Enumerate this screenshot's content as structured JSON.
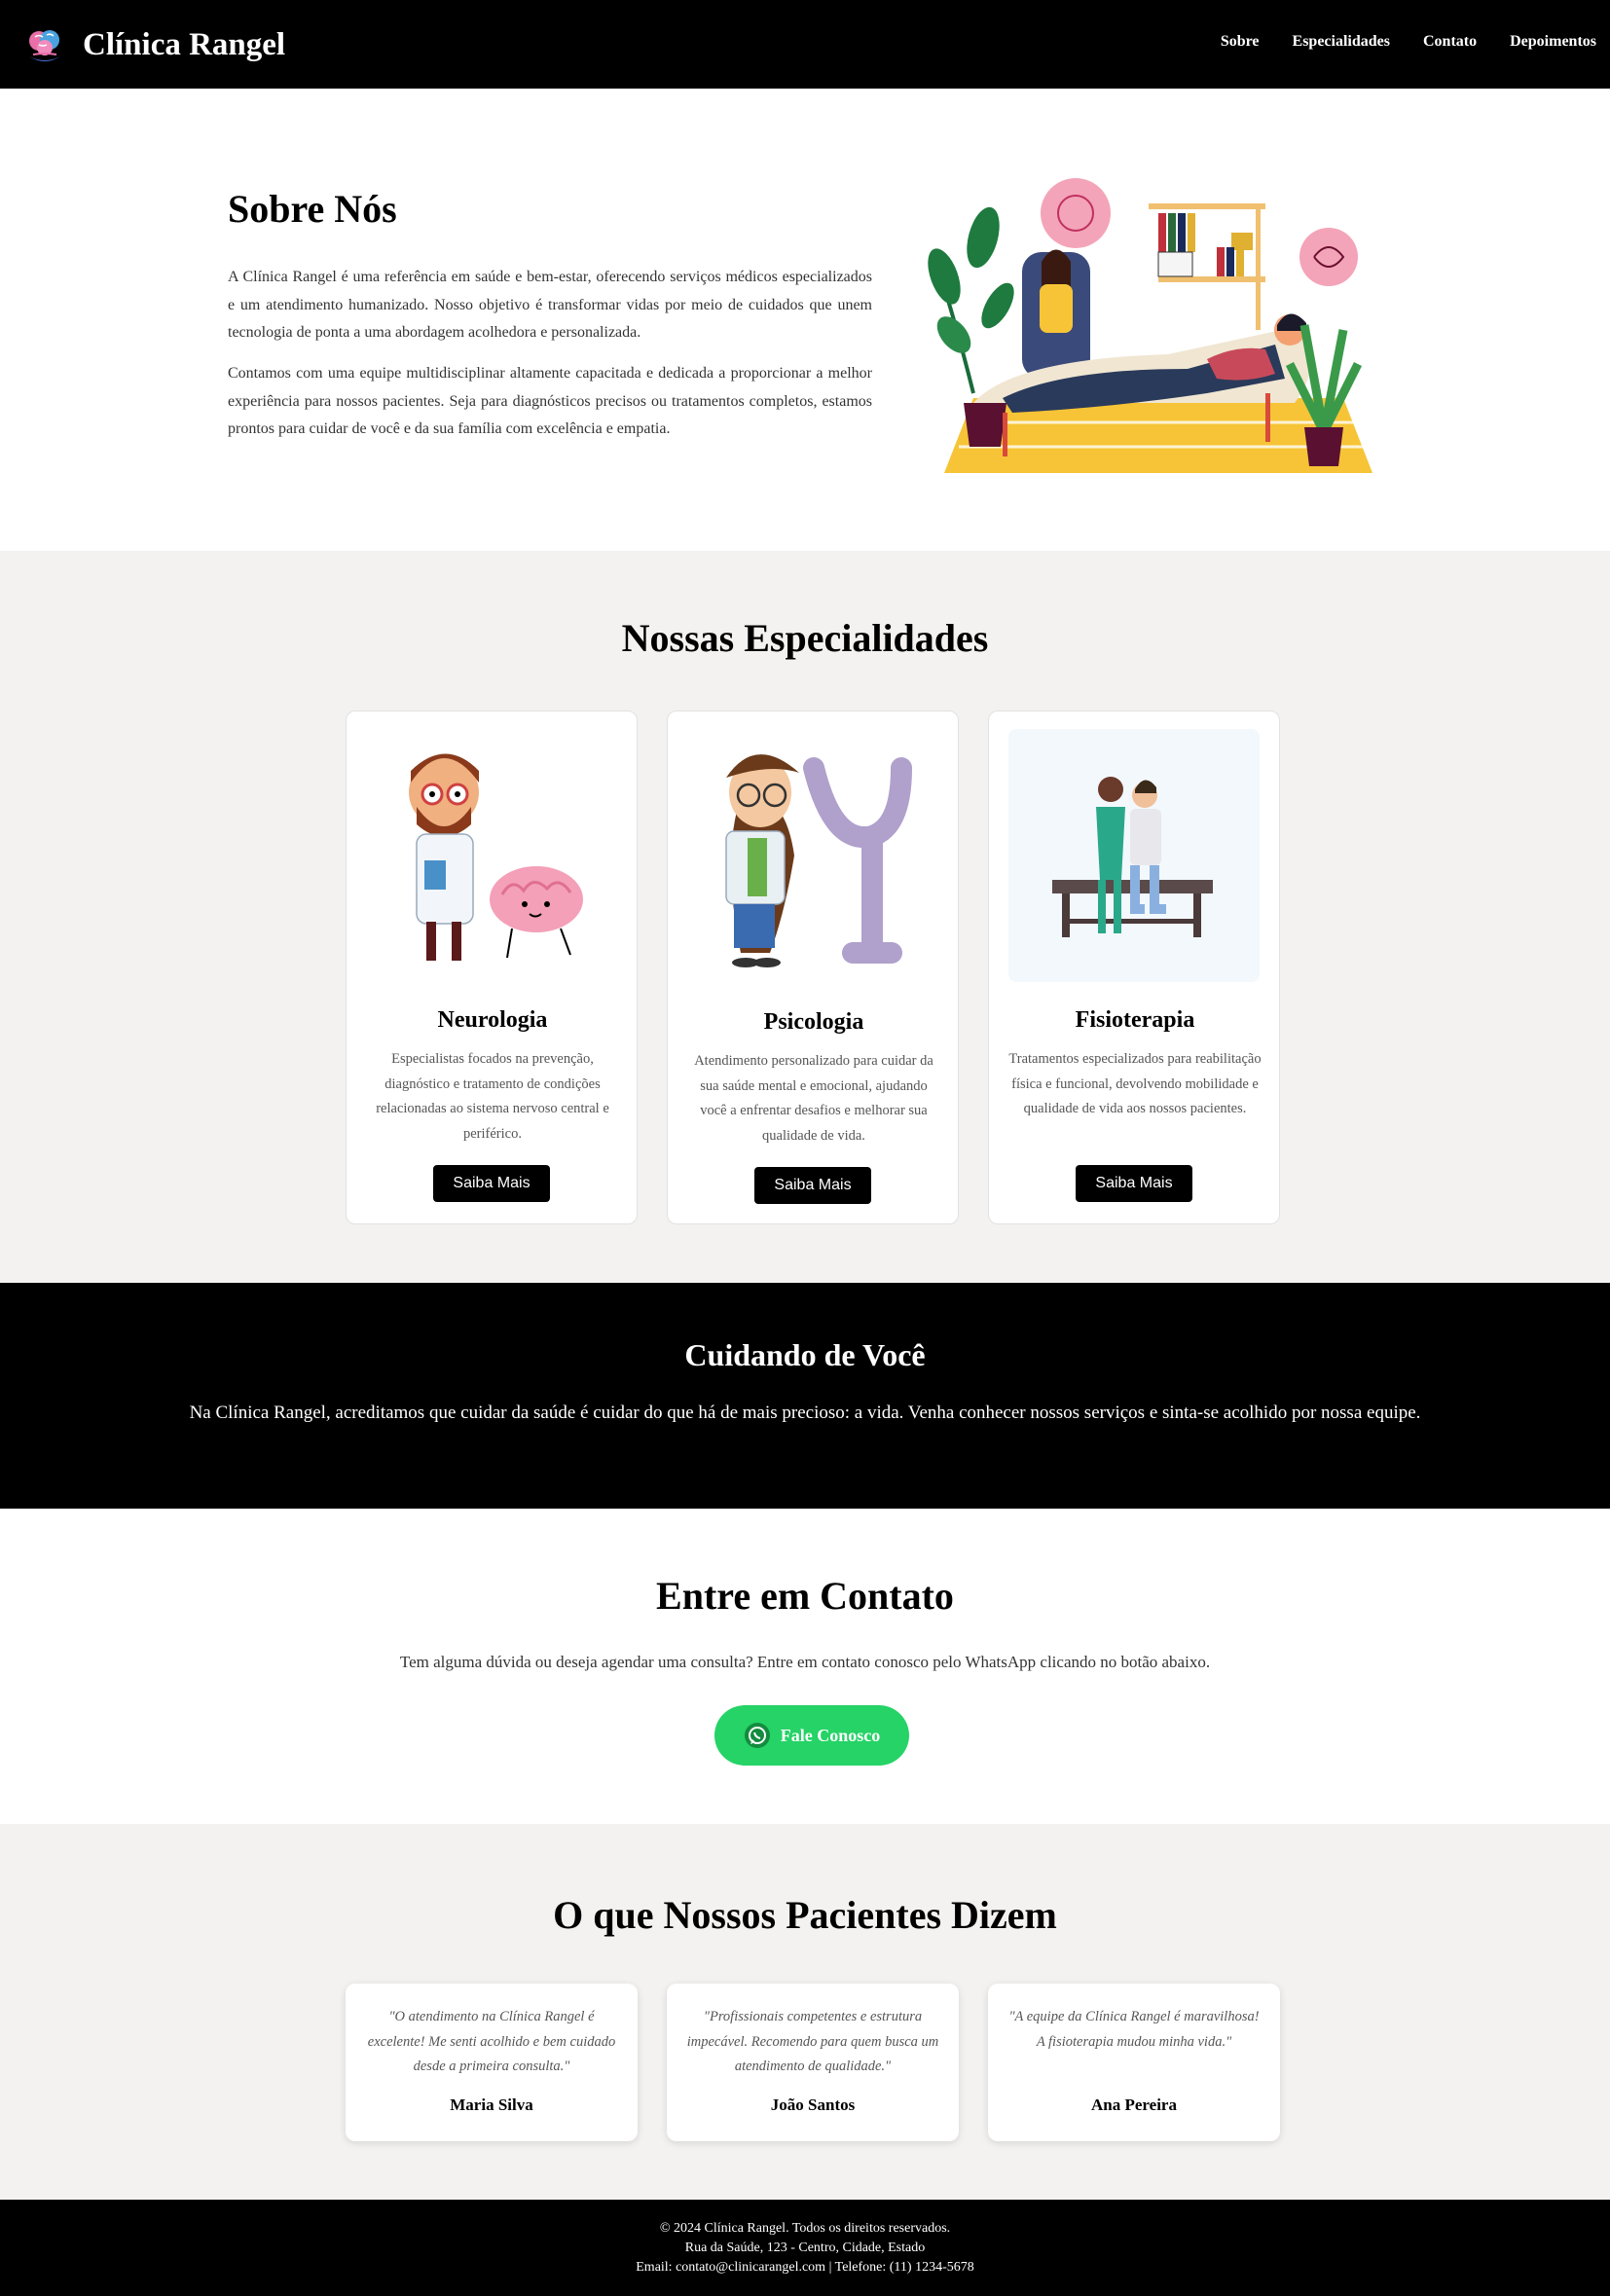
{
  "header": {
    "brand": "Clínica Rangel",
    "nav": [
      "Sobre",
      "Especialidades",
      "Contato",
      "Depoimentos"
    ]
  },
  "about": {
    "title": "Sobre Nós",
    "p1": "A Clínica Rangel é uma referência em saúde e bem-estar, oferecendo serviços médicos especializados e um atendimento humanizado. Nosso objetivo é transformar vidas por meio de cuidados que unem tecnologia de ponta a uma abordagem acolhedora e personalizada.",
    "p2": "Contamos com uma equipe multidisciplinar altamente capacitada e dedicada a proporcionar a melhor experiência para nossos pacientes. Seja para diagnósticos precisos ou tratamentos completos, estamos prontos para cuidar de você e da sua família com excelência e empatia."
  },
  "specialties": {
    "title": "Nossas Especialidades",
    "cards": [
      {
        "title": "Neurologia",
        "text": "Especialistas focados na prevenção, diagnóstico e tratamento de condições relacionadas ao sistema nervoso central e periférico.",
        "button": "Saiba Mais"
      },
      {
        "title": "Psicologia",
        "text": "Atendimento personalizado para cuidar da sua saúde mental e emocional, ajudando você a enfrentar desafios e melhorar sua qualidade de vida.",
        "button": "Saiba Mais"
      },
      {
        "title": "Fisioterapia",
        "text": "Tratamentos especializados para reabilitação física e funcional, devolvendo mobilidade e qualidade de vida aos nossos pacientes.",
        "button": "Saiba Mais"
      }
    ]
  },
  "caring": {
    "title": "Cuidando de Você",
    "text": "Na Clínica Rangel, acreditamos que cuidar da saúde é cuidar do que há de mais precioso: a vida. Venha conhecer nossos serviços e sinta-se acolhido por nossa equipe."
  },
  "contact": {
    "title": "Entre em Contato",
    "text": "Tem alguma dúvida ou deseja agendar uma consulta? Entre em contato conosco pelo WhatsApp clicando no botão abaixo.",
    "button": "Fale Conosco",
    "button_color": "#25d366"
  },
  "testimonials": {
    "title": "O que Nossos Pacientes Dizem",
    "items": [
      {
        "quote": "\"O atendimento na Clínica Rangel é excelente! Me senti acolhido e bem cuidado desde a primeira consulta.\"",
        "name": "Maria Silva"
      },
      {
        "quote": "\"Profissionais competentes e estrutura impecável. Recomendo para quem busca um atendimento de qualidade.\"",
        "name": "João Santos"
      },
      {
        "quote": "\"A equipe da Clínica Rangel é maravilhosa! A fisioterapia mudou minha vida.\"",
        "name": "Ana Pereira"
      }
    ]
  },
  "footer": {
    "line1": "© 2024 Clínica Rangel. Todos os direitos reservados.",
    "line2": "Rua da Saúde, 123 - Centro, Cidade, Estado",
    "line3": "Email: contato@clinicarangel.com | Telefone: (11) 1234-5678"
  }
}
